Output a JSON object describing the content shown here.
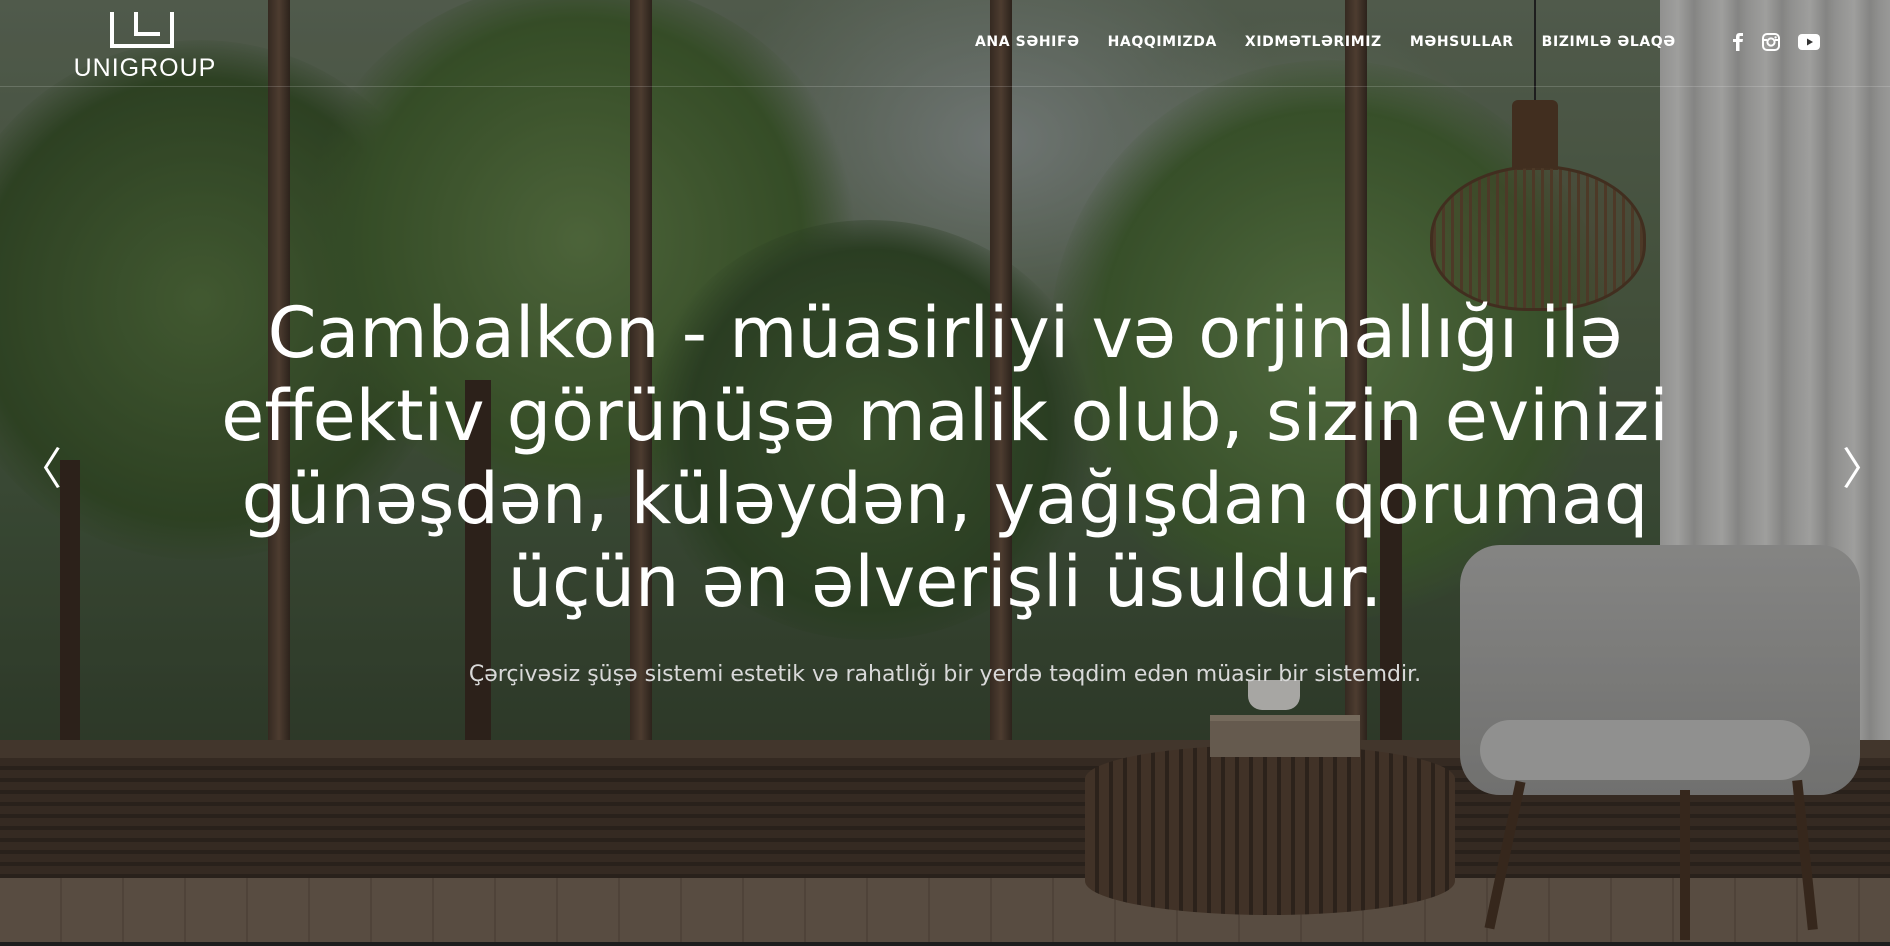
{
  "brand": {
    "name": "UNIGROUP"
  },
  "nav": {
    "items": [
      {
        "label": "ANA SƏHIFƏ"
      },
      {
        "label": "HAQQIMIZDA"
      },
      {
        "label": "XIDMƏTLƏRIMIZ"
      },
      {
        "label": "MƏHSULLAR"
      },
      {
        "label": "BIZIMLƏ ƏLAQƏ"
      }
    ]
  },
  "social": {
    "icons": [
      "facebook-icon",
      "instagram-icon",
      "youtube-icon"
    ]
  },
  "hero": {
    "headline": "Cambalkon - müasirliyi və orjinallığı ilə effektiv görünüşə malik olub, sizin evinizi günəşdən, küləydən, yağışdan qorumaq üçün ən əlverişli üsuldur.",
    "subline": "Çərçivəsiz şüşə sistemi estetik və rahatlığı bir yerdə təqdim edən müasir bir sistemdir.",
    "prev_glyph": "〈",
    "next_glyph": "〉"
  },
  "colors": {
    "text": "#ffffff",
    "subtext": "#d9d9d9"
  }
}
